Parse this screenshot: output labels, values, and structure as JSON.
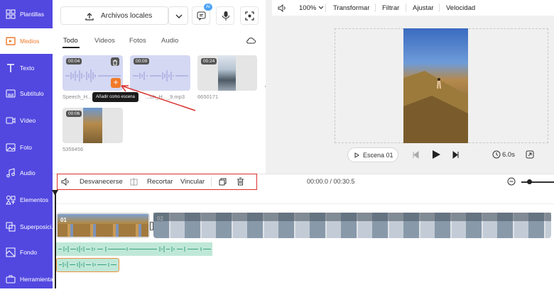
{
  "sidebar": {
    "items": [
      {
        "label": "Plantillas",
        "icon": "template-icon"
      },
      {
        "label": "Medios",
        "icon": "media-icon",
        "active": true
      },
      {
        "label": "Texto",
        "icon": "text-icon"
      },
      {
        "label": "Subtítulo",
        "icon": "subtitle-icon"
      },
      {
        "label": "Vídeo",
        "icon": "video-icon"
      },
      {
        "label": "Foto",
        "icon": "photo-icon"
      },
      {
        "label": "Audio",
        "icon": "audio-icon"
      },
      {
        "label": "Elementos",
        "icon": "elements-icon"
      },
      {
        "label": "Superposici...",
        "icon": "overlay-icon"
      },
      {
        "label": "Fondo",
        "icon": "background-icon"
      },
      {
        "label": "Herramientas",
        "icon": "tools-icon"
      }
    ]
  },
  "media": {
    "source_label": "Archivos locales",
    "ai_badge": "AI",
    "tabs": [
      "Todo",
      "Videos",
      "Fotos",
      "Audio"
    ],
    "active_tab": "Todo",
    "items": [
      {
        "duration": "00:04",
        "name": "Speech_H...",
        "kind": "audio"
      },
      {
        "duration": "00:09",
        "name": "...ch_H..._9.mp3",
        "kind": "audio"
      },
      {
        "duration": "00:24",
        "name": "6650171",
        "kind": "video"
      },
      {
        "duration": "00:06",
        "name": "5359456",
        "kind": "video"
      }
    ],
    "tooltip": "Añadir como escena"
  },
  "preview": {
    "toolbar": {
      "zoom": "100%",
      "transform": "Transformar",
      "filter": "Filtrar",
      "adjust": "Ajustar",
      "speed": "Velocidad"
    },
    "scene_label": "Escena 01",
    "duration": "6.0s"
  },
  "timeline": {
    "toolbar": {
      "fade": "Desvanecerse",
      "trim": "Recortar",
      "link": "Vincular"
    },
    "time": "00:00.0 / 00:30.5",
    "clips": [
      {
        "label": "01"
      },
      {
        "label": "02"
      }
    ]
  },
  "colors": {
    "sidebar": "#5248e0",
    "accent": "#f07a2a",
    "annotation": "#d9312e"
  }
}
